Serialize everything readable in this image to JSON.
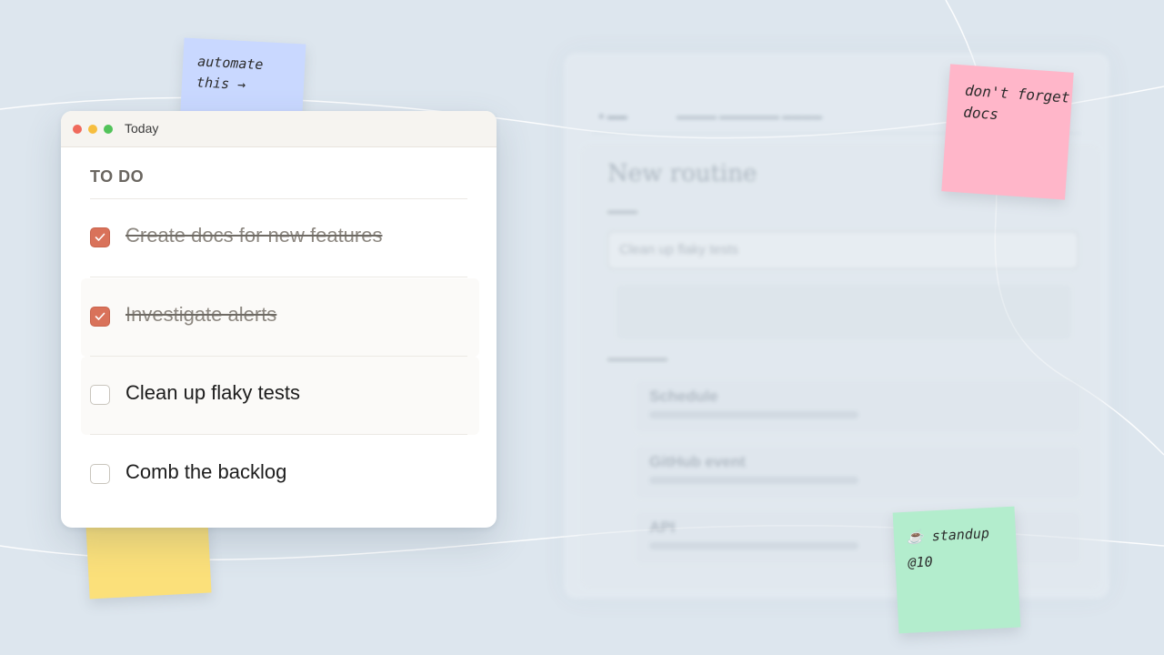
{
  "window": {
    "title": "Today"
  },
  "todo": {
    "heading": "TO DO",
    "tasks": [
      {
        "label": "Create docs for new features",
        "done": true
      },
      {
        "label": "Investigate alerts",
        "done": true
      },
      {
        "label": "Clean up flaky tests",
        "done": false
      },
      {
        "label": "Comb the backlog",
        "done": false
      }
    ]
  },
  "stickies": {
    "blue": "automate\nthis →",
    "pink": "don't forget\ndocs",
    "yellow": "",
    "green": "☕ standup\n@10"
  },
  "background_window": {
    "title": "New routine",
    "field_value": "Clean up flaky tests",
    "triggers": [
      "Schedule",
      "GitHub event",
      "API"
    ]
  },
  "colors": {
    "background": "#dde6ee",
    "check_accent": "#d9725a",
    "sticky_blue": "#c9d8ff",
    "sticky_pink": "#ffb6c9",
    "sticky_yellow": "#fbe07a",
    "sticky_green": "#b3edcd"
  },
  "icons": {
    "checkmark": "check-icon",
    "window_controls": [
      "close-dot",
      "minimize-dot",
      "zoom-dot"
    ]
  }
}
